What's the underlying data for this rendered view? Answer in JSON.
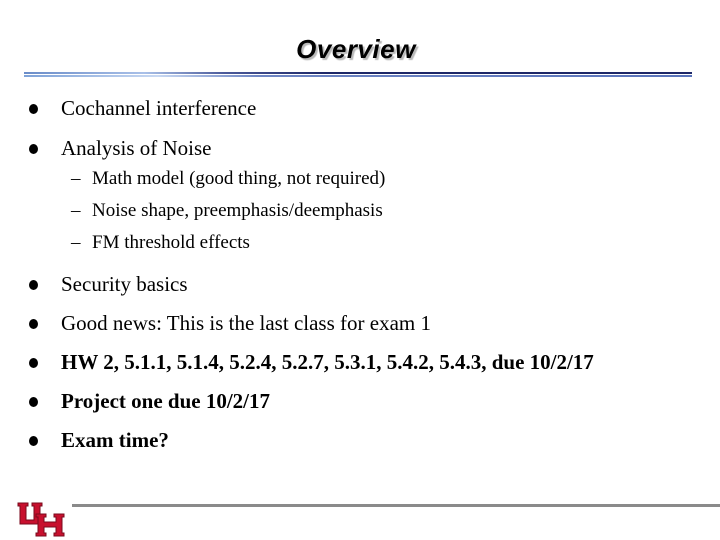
{
  "slide": {
    "title": "Overview",
    "bullets": [
      {
        "text": "Cochannel interference",
        "bold": false
      },
      {
        "text": "Analysis of Noise",
        "bold": false,
        "sub": [
          "Math model (good thing, not required)",
          "Noise shape, preemphasis/deemphasis",
          "FM threshold effects"
        ]
      },
      {
        "text": "Security basics",
        "bold": false
      },
      {
        "text": "Good news: This is the last class for exam 1",
        "bold": false
      },
      {
        "text": "HW 2, 5.1.1, 5.1.4, 5.2.4, 5.2.7, 5.3.1, 5.4.2, 5.4.3, due 10/2/17",
        "bold": true
      },
      {
        "text": "Project one due 10/2/17",
        "bold": true
      },
      {
        "text": "Exam time?",
        "bold": true
      }
    ],
    "sub_dash": "–",
    "logo": {
      "text": "UH",
      "icon": "uh-logo",
      "color": "#c8102e"
    }
  }
}
